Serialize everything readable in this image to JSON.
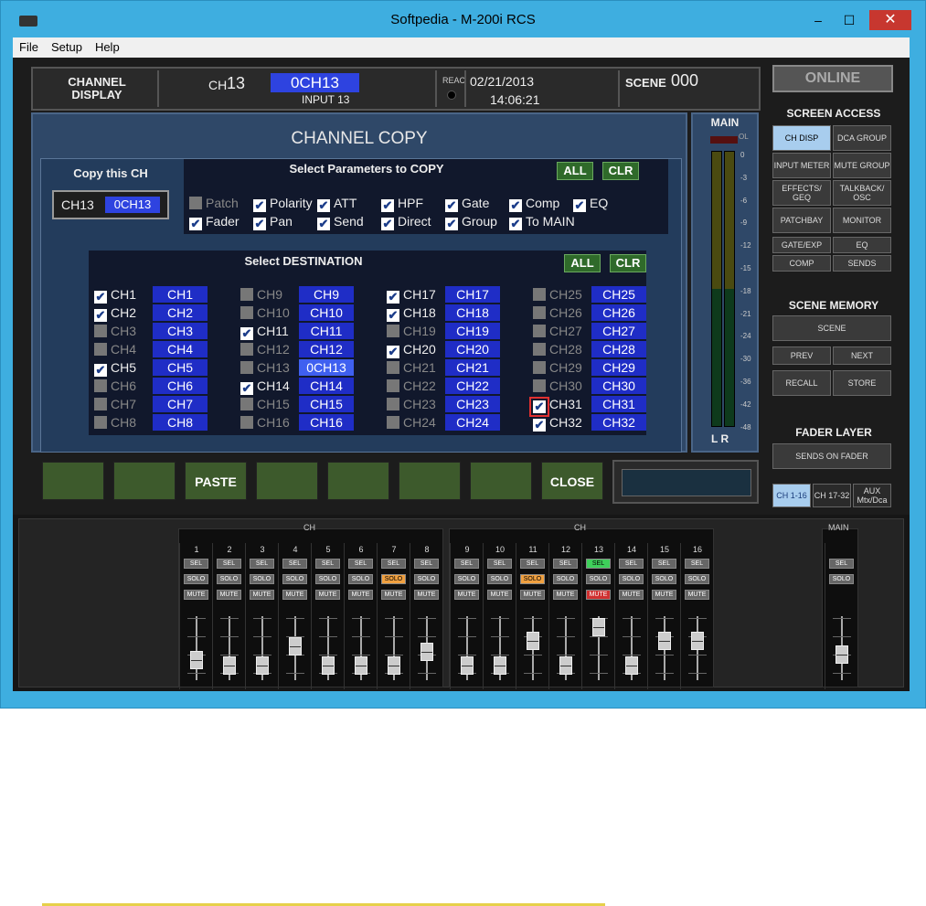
{
  "window": {
    "title": "Softpedia - M-200i RCS",
    "min": "–",
    "max": "☐",
    "close": "✕"
  },
  "menu": [
    "File",
    "Setup",
    "Help"
  ],
  "header": {
    "mode_line1": "CHANNEL",
    "mode_line2": "DISPLAY",
    "ch_label": "CH",
    "ch_number": "13",
    "ch_name": "0CH13",
    "input": "INPUT 13",
    "reac": "REAC",
    "date": "02/21/2013",
    "time": "14:06:21",
    "scene_label": "SCENE",
    "scene_number": "000"
  },
  "copy": {
    "title": "CHANNEL COPY",
    "copy_this": "Copy this CH",
    "src_ch": "CH13",
    "src_name": "0CH13",
    "params_title": "Select Parameters to COPY",
    "all": "ALL",
    "clr": "CLR",
    "params": [
      {
        "label": "Patch",
        "checked": false,
        "disabled": true
      },
      {
        "label": "Polarity",
        "checked": true
      },
      {
        "label": "ATT",
        "checked": true
      },
      {
        "label": "HPF",
        "checked": true
      },
      {
        "label": "Gate",
        "checked": true
      },
      {
        "label": "Comp",
        "checked": true
      },
      {
        "label": "EQ",
        "checked": true
      },
      {
        "label": "Fader",
        "checked": true
      },
      {
        "label": "Pan",
        "checked": true
      },
      {
        "label": "Send",
        "checked": true
      },
      {
        "label": "Direct",
        "checked": true
      },
      {
        "label": "Group",
        "checked": true
      },
      {
        "label": "To MAIN",
        "checked": true
      }
    ],
    "dest_title": "Select DESTINATION",
    "dest_checked": [
      1,
      2,
      5,
      11,
      14,
      17,
      18,
      20,
      31,
      32
    ],
    "dest_disabled": [
      13
    ],
    "dest_focus": 31,
    "dest_names": [
      "CH1",
      "CH2",
      "CH3",
      "CH4",
      "CH5",
      "CH6",
      "CH7",
      "CH8",
      "CH9",
      "CH10",
      "CH11",
      "CH12",
      "0CH13",
      "CH14",
      "CH15",
      "CH16",
      "CH17",
      "CH18",
      "CH19",
      "CH20",
      "CH21",
      "CH22",
      "CH23",
      "CH24",
      "CH25",
      "CH26",
      "CH27",
      "CH28",
      "CH29",
      "CH30",
      "CH31",
      "CH32"
    ]
  },
  "softkeys": [
    "",
    "",
    "PASTE",
    "",
    "",
    "",
    "",
    "CLOSE"
  ],
  "meter": {
    "title": "MAIN",
    "ol": "OL",
    "ticks": [
      "0",
      "-3",
      "-6",
      "-9",
      "-12",
      "-15",
      "-18",
      "-21",
      "-24",
      "-30",
      "-36",
      "-42",
      "-48"
    ],
    "lr": "L R"
  },
  "side": {
    "online": "ONLINE",
    "screen_access": "SCREEN ACCESS",
    "buttons": [
      "CH DISP",
      "DCA GROUP",
      "INPUT METER",
      "MUTE GROUP",
      "EFFECTS/ GEQ",
      "TALKBACK/ OSC",
      "PATCHBAY",
      "MONITOR",
      "GATE/EXP",
      "EQ",
      "COMP",
      "SENDS"
    ],
    "scene_memory": "SCENE MEMORY",
    "scene": "SCENE",
    "prev": "PREV",
    "next": "NEXT",
    "recall": "RECALL",
    "store": "STORE",
    "fader_layer": "FADER LAYER",
    "sends_on_fader": "SENDS ON FADER",
    "layers": [
      "CH 1-16",
      "CH 17-32",
      "AUX Mtx/Dca"
    ]
  },
  "mixer": {
    "group_label": "CH",
    "main_label": "MAIN",
    "sel": "SEL",
    "solo": "SOLO",
    "mute": "MUTE",
    "strips": [
      {
        "n": "1",
        "fader": 0.2
      },
      {
        "n": "2",
        "fader": 0.1
      },
      {
        "n": "3",
        "fader": 0.1
      },
      {
        "n": "4",
        "fader": 0.45
      },
      {
        "n": "5",
        "fader": 0.1
      },
      {
        "n": "6",
        "fader": 0.1
      },
      {
        "n": "7",
        "fader": 0.1,
        "solo": true
      },
      {
        "n": "8",
        "fader": 0.35
      },
      {
        "n": "9",
        "fader": 0.1
      },
      {
        "n": "10",
        "fader": 0.1
      },
      {
        "n": "11",
        "fader": 0.55,
        "solo": true
      },
      {
        "n": "12",
        "fader": 0.1
      },
      {
        "n": "13",
        "fader": 0.8,
        "sel": true,
        "mute": true
      },
      {
        "n": "14",
        "fader": 0.1
      },
      {
        "n": "15",
        "fader": 0.55
      },
      {
        "n": "16",
        "fader": 0.55
      }
    ],
    "main_fader": 0.3
  }
}
